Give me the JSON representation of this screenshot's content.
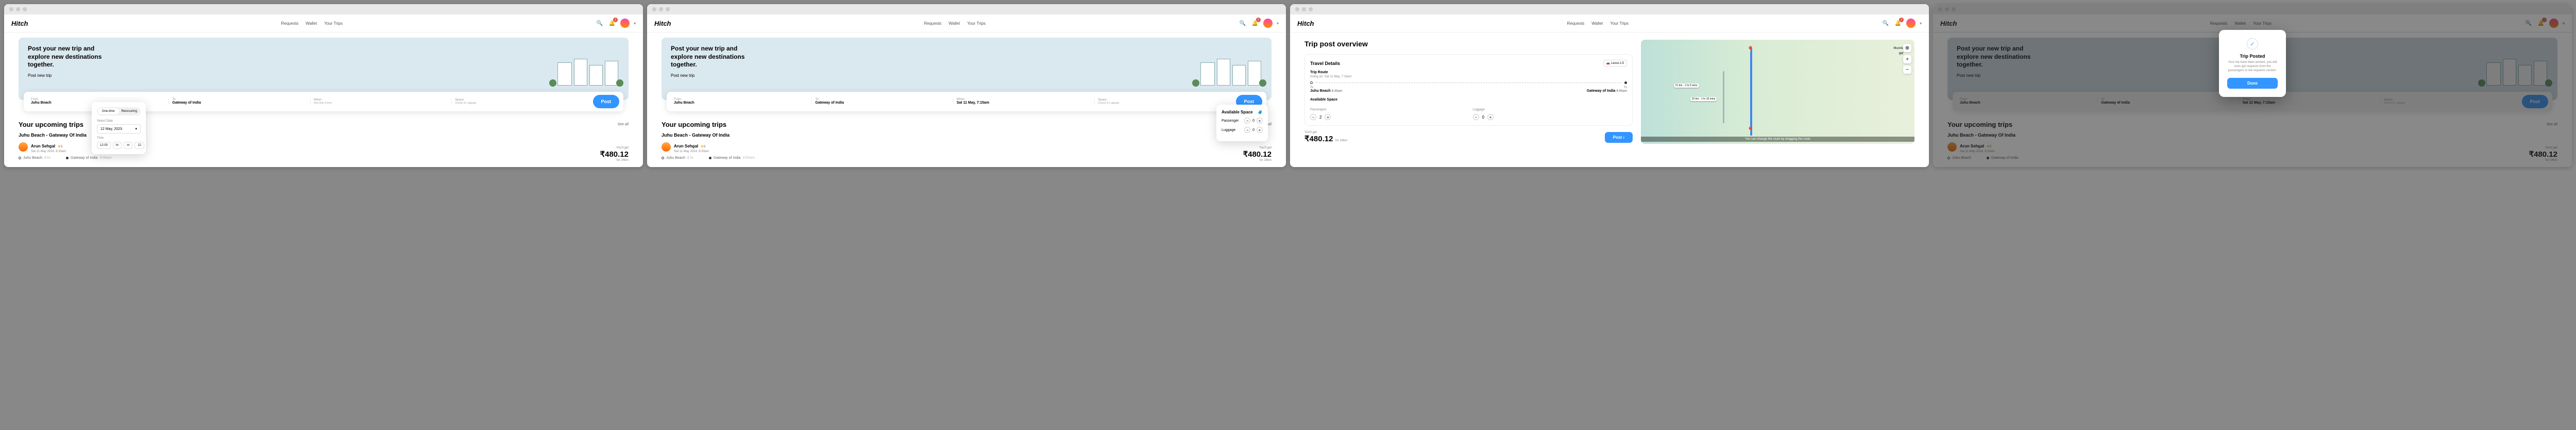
{
  "brand": "Hitch",
  "nav": {
    "requests": "Requests",
    "wallet": "Wallet",
    "trips": "Your Trips",
    "notif_count": "2"
  },
  "hero": {
    "headline": "Post your new trip and explore new destinations together.",
    "cta": "Post new trip"
  },
  "form": {
    "from_label": "From",
    "from_value": "Juhu Beach",
    "to_label": "To",
    "to_value": "Gateway of India",
    "when_label": "When",
    "when_placeholder": "Add date & time",
    "when_value": "Sat 11 May, 7:15am",
    "space_label": "Space",
    "space_placeholder": "Guests & Luggage",
    "post": "Post"
  },
  "datepicker": {
    "tab_one": "One-time",
    "tab_rec": "Reoccuring",
    "select_date": "Select Date",
    "date_value": "12 May, 2023",
    "time_label": "Time",
    "time_value": "12:00",
    "seg1": "hr",
    "seg2": "m",
    "seg3": "12"
  },
  "spacepicker": {
    "title": "Available Space",
    "passenger": "Passenger",
    "luggage": "Luggage",
    "passenger_val": "0",
    "luggage_val": "0"
  },
  "upcoming": {
    "title": "Your upcoming trips",
    "seeall": "See all",
    "route": "Juhu Beach - Gateway Of India",
    "driver": "Arun Sehgal",
    "rating": "5",
    "date": "Sat 11 May 2024, 8:30am",
    "from": "Juhu Beach",
    "from_time": "8 hr",
    "to": "Gateway of India",
    "to_time": "9:00am",
    "price_label": "You'll get",
    "price": "₹480.12",
    "price_sub": "for 24km"
  },
  "overview": {
    "title": "Trip post overview",
    "travel_details": "Travel Details",
    "car": "Lexus LS",
    "trip_route": "Trip Route",
    "going_on": "Going on: Sat 11 May, 7:15am",
    "from": "Juhu Beach",
    "from_time": "8:30am",
    "to": "Gateway of India",
    "to_time": "9:00am",
    "to_label": "To",
    "space_title": "Available Space",
    "passengers": "Passengers",
    "passengers_val": "2",
    "luggage": "Luggage",
    "luggage_val": "0",
    "price_label": "You'll get",
    "price": "₹480.12",
    "price_sub": "for 24km",
    "post": "Post",
    "map_note": "You can change the route by dragging the route",
    "map_city": "Mumbai",
    "map_city_local": "मुंबई",
    "map_pill1": "21 km - 1 hr 5 mins",
    "map_pill2": "23 km - 1 hr 15 mins"
  },
  "modal": {
    "title": "Trip Posted",
    "body": "Your trip have been posted, you will soon get requests from the passengers in the requests section.",
    "done": "Done"
  }
}
